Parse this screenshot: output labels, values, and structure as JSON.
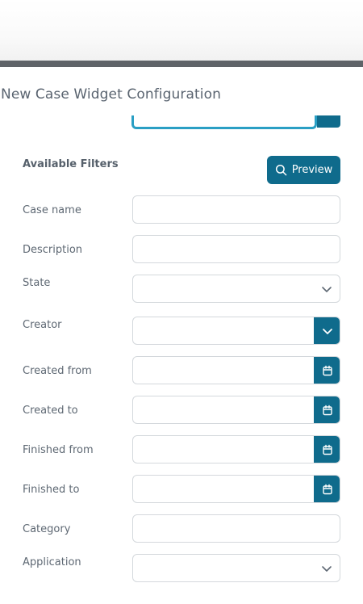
{
  "dialog": {
    "title": "New Case Widget Configuration"
  },
  "filters": {
    "section_title": "Available Filters",
    "preview_label": "Preview",
    "rows": [
      {
        "label": "Case name",
        "type": "text",
        "value": ""
      },
      {
        "label": "Description",
        "type": "text",
        "value": ""
      },
      {
        "label": "State",
        "type": "select",
        "value": ""
      },
      {
        "label": "Creator",
        "type": "select-button",
        "value": ""
      },
      {
        "label": "Created from",
        "type": "date",
        "value": ""
      },
      {
        "label": "Created to",
        "type": "date",
        "value": ""
      },
      {
        "label": "Finished from",
        "type": "date",
        "value": ""
      },
      {
        "label": "Finished to",
        "type": "date",
        "value": ""
      },
      {
        "label": "Category",
        "type": "text",
        "value": ""
      },
      {
        "label": "Application",
        "type": "select",
        "value": ""
      }
    ]
  },
  "colors": {
    "primary": "#0f6b8c",
    "focus_border": "#2a9fc4",
    "top_bar": "#5f6368"
  },
  "icons": {
    "preview": "search-icon",
    "select": "chevron-down-icon",
    "date": "calendar-icon"
  }
}
